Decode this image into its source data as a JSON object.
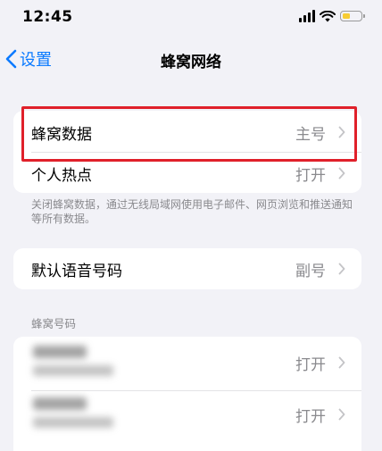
{
  "status_bar": {
    "time": "12:45"
  },
  "nav": {
    "back_label": "设置",
    "title": "蜂窝网络"
  },
  "group1": {
    "rows": [
      {
        "label": "蜂窝数据",
        "value": "主号"
      },
      {
        "label": "个人热点",
        "value": "打开"
      }
    ]
  },
  "footer_note": "关闭蜂窝数据，通过无线局域网使用电子邮件、网页浏览和推送通知等所有数据。",
  "group2": {
    "rows": [
      {
        "label": "默认语音号码",
        "value": "副号"
      }
    ]
  },
  "section_header": "蜂窝号码",
  "group3": {
    "rows": [
      {
        "label": "",
        "value": "打开"
      },
      {
        "label": "",
        "value": "打开"
      }
    ]
  },
  "colors": {
    "accent": "#0a7aff",
    "highlight": "#e0202a",
    "battery": "#f7cc33"
  },
  "icons": [
    "signal-icon",
    "wifi-icon",
    "battery-icon",
    "chevron-left-icon",
    "chevron-right-icon"
  ]
}
